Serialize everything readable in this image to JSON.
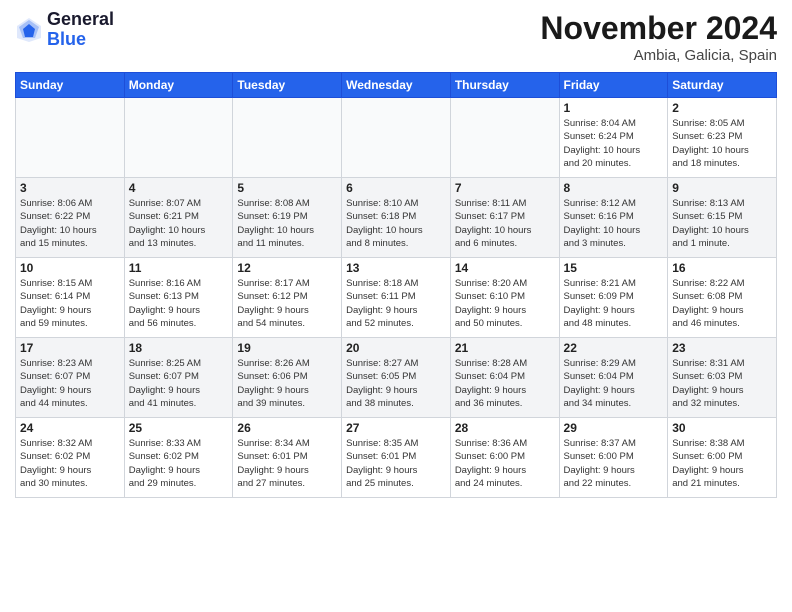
{
  "header": {
    "logo_general": "General",
    "logo_blue": "Blue",
    "month_title": "November 2024",
    "location": "Ambia, Galicia, Spain"
  },
  "days_of_week": [
    "Sunday",
    "Monday",
    "Tuesday",
    "Wednesday",
    "Thursday",
    "Friday",
    "Saturday"
  ],
  "weeks": [
    {
      "days": [
        {
          "num": "",
          "info": ""
        },
        {
          "num": "",
          "info": ""
        },
        {
          "num": "",
          "info": ""
        },
        {
          "num": "",
          "info": ""
        },
        {
          "num": "",
          "info": ""
        },
        {
          "num": "1",
          "info": "Sunrise: 8:04 AM\nSunset: 6:24 PM\nDaylight: 10 hours\nand 20 minutes."
        },
        {
          "num": "2",
          "info": "Sunrise: 8:05 AM\nSunset: 6:23 PM\nDaylight: 10 hours\nand 18 minutes."
        }
      ]
    },
    {
      "days": [
        {
          "num": "3",
          "info": "Sunrise: 8:06 AM\nSunset: 6:22 PM\nDaylight: 10 hours\nand 15 minutes."
        },
        {
          "num": "4",
          "info": "Sunrise: 8:07 AM\nSunset: 6:21 PM\nDaylight: 10 hours\nand 13 minutes."
        },
        {
          "num": "5",
          "info": "Sunrise: 8:08 AM\nSunset: 6:19 PM\nDaylight: 10 hours\nand 11 minutes."
        },
        {
          "num": "6",
          "info": "Sunrise: 8:10 AM\nSunset: 6:18 PM\nDaylight: 10 hours\nand 8 minutes."
        },
        {
          "num": "7",
          "info": "Sunrise: 8:11 AM\nSunset: 6:17 PM\nDaylight: 10 hours\nand 6 minutes."
        },
        {
          "num": "8",
          "info": "Sunrise: 8:12 AM\nSunset: 6:16 PM\nDaylight: 10 hours\nand 3 minutes."
        },
        {
          "num": "9",
          "info": "Sunrise: 8:13 AM\nSunset: 6:15 PM\nDaylight: 10 hours\nand 1 minute."
        }
      ]
    },
    {
      "days": [
        {
          "num": "10",
          "info": "Sunrise: 8:15 AM\nSunset: 6:14 PM\nDaylight: 9 hours\nand 59 minutes."
        },
        {
          "num": "11",
          "info": "Sunrise: 8:16 AM\nSunset: 6:13 PM\nDaylight: 9 hours\nand 56 minutes."
        },
        {
          "num": "12",
          "info": "Sunrise: 8:17 AM\nSunset: 6:12 PM\nDaylight: 9 hours\nand 54 minutes."
        },
        {
          "num": "13",
          "info": "Sunrise: 8:18 AM\nSunset: 6:11 PM\nDaylight: 9 hours\nand 52 minutes."
        },
        {
          "num": "14",
          "info": "Sunrise: 8:20 AM\nSunset: 6:10 PM\nDaylight: 9 hours\nand 50 minutes."
        },
        {
          "num": "15",
          "info": "Sunrise: 8:21 AM\nSunset: 6:09 PM\nDaylight: 9 hours\nand 48 minutes."
        },
        {
          "num": "16",
          "info": "Sunrise: 8:22 AM\nSunset: 6:08 PM\nDaylight: 9 hours\nand 46 minutes."
        }
      ]
    },
    {
      "days": [
        {
          "num": "17",
          "info": "Sunrise: 8:23 AM\nSunset: 6:07 PM\nDaylight: 9 hours\nand 44 minutes."
        },
        {
          "num": "18",
          "info": "Sunrise: 8:25 AM\nSunset: 6:07 PM\nDaylight: 9 hours\nand 41 minutes."
        },
        {
          "num": "19",
          "info": "Sunrise: 8:26 AM\nSunset: 6:06 PM\nDaylight: 9 hours\nand 39 minutes."
        },
        {
          "num": "20",
          "info": "Sunrise: 8:27 AM\nSunset: 6:05 PM\nDaylight: 9 hours\nand 38 minutes."
        },
        {
          "num": "21",
          "info": "Sunrise: 8:28 AM\nSunset: 6:04 PM\nDaylight: 9 hours\nand 36 minutes."
        },
        {
          "num": "22",
          "info": "Sunrise: 8:29 AM\nSunset: 6:04 PM\nDaylight: 9 hours\nand 34 minutes."
        },
        {
          "num": "23",
          "info": "Sunrise: 8:31 AM\nSunset: 6:03 PM\nDaylight: 9 hours\nand 32 minutes."
        }
      ]
    },
    {
      "days": [
        {
          "num": "24",
          "info": "Sunrise: 8:32 AM\nSunset: 6:02 PM\nDaylight: 9 hours\nand 30 minutes."
        },
        {
          "num": "25",
          "info": "Sunrise: 8:33 AM\nSunset: 6:02 PM\nDaylight: 9 hours\nand 29 minutes."
        },
        {
          "num": "26",
          "info": "Sunrise: 8:34 AM\nSunset: 6:01 PM\nDaylight: 9 hours\nand 27 minutes."
        },
        {
          "num": "27",
          "info": "Sunrise: 8:35 AM\nSunset: 6:01 PM\nDaylight: 9 hours\nand 25 minutes."
        },
        {
          "num": "28",
          "info": "Sunrise: 8:36 AM\nSunset: 6:00 PM\nDaylight: 9 hours\nand 24 minutes."
        },
        {
          "num": "29",
          "info": "Sunrise: 8:37 AM\nSunset: 6:00 PM\nDaylight: 9 hours\nand 22 minutes."
        },
        {
          "num": "30",
          "info": "Sunrise: 8:38 AM\nSunset: 6:00 PM\nDaylight: 9 hours\nand 21 minutes."
        }
      ]
    }
  ]
}
